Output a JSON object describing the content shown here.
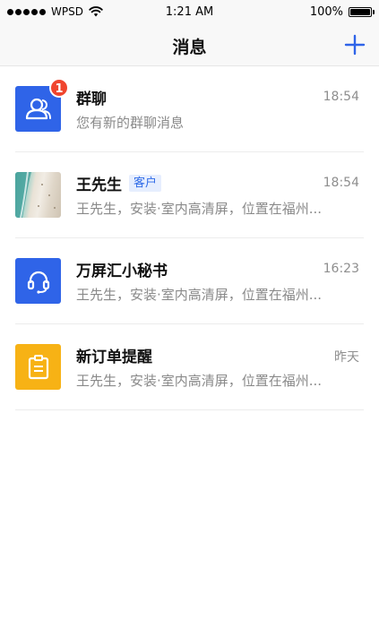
{
  "status_bar": {
    "carrier": "WPSD",
    "time": "1:21 AM",
    "battery": "100%"
  },
  "nav": {
    "title": "消息",
    "plus_icon": "plus-icon"
  },
  "colors": {
    "accent": "#2f64e8",
    "badge": "#f0452e",
    "reminder": "#f7b215"
  },
  "messages": [
    {
      "title": "群聊",
      "badge": "1",
      "time": "18:54",
      "preview": "您有新的群聊消息",
      "icon": "group-chat-icon"
    },
    {
      "title": "王先生",
      "tag": "客户",
      "time": "18:54",
      "preview": "王先生，安装·室内高清屏，位置在福州...",
      "icon": "avatar-photo"
    },
    {
      "title": "万屏汇小秘书",
      "time": "16:23",
      "preview": "王先生，安装·室内高清屏，位置在福州...",
      "icon": "headset-icon"
    },
    {
      "title": "新订单提醒",
      "time": "昨天",
      "preview": "王先生，安装·室内高清屏，位置在福州...",
      "icon": "clipboard-icon"
    }
  ]
}
